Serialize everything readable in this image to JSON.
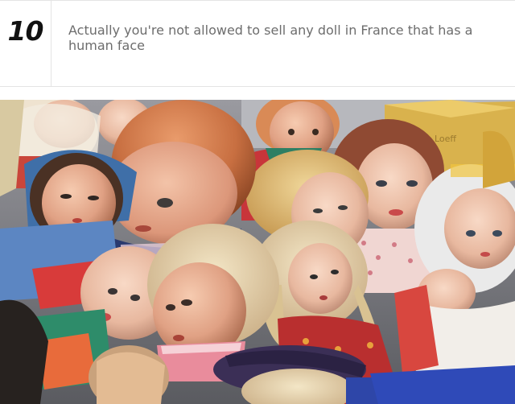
{
  "fact": {
    "number": "10",
    "text": "Actually you're not allowed to sell any doll in France that has a human face"
  },
  "photo": {
    "subject": "dolls-photo"
  }
}
